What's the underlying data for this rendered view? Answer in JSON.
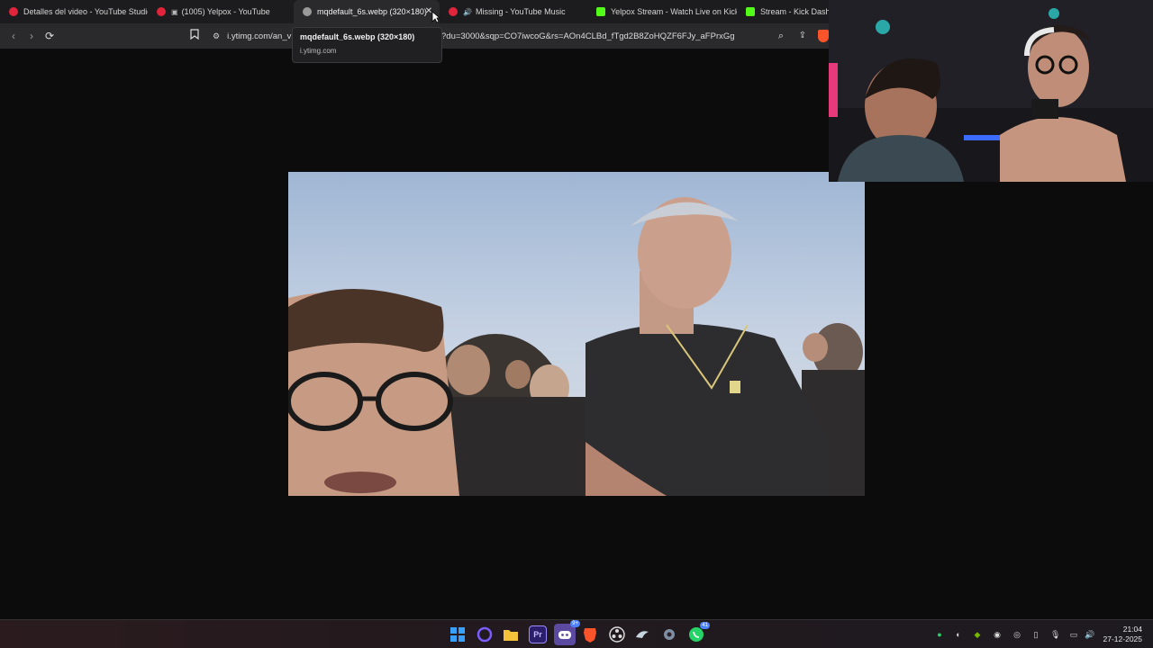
{
  "browser": {
    "tabs": [
      {
        "label": "Detalles del video - YouTube Studio",
        "icon": "youtube-studio-icon",
        "color": "#e0243b"
      },
      {
        "label": "(1005) Yelpox - YouTube",
        "icon": "youtube-icon",
        "color": "#e0243b"
      },
      {
        "label": "mqdefault_6s.webp (320×180)",
        "icon": "globe-icon",
        "color": "#b5b5b5"
      },
      {
        "label": "Missing - YouTube Music",
        "icon": "youtube-music-icon",
        "color": "#e0243b"
      },
      {
        "label": "Yelpox Stream - Watch Live on Kick",
        "icon": "kick-icon",
        "color": "#53fc18"
      },
      {
        "label": "Stream - Kick Dashb",
        "icon": "kick-icon",
        "color": "#53fc18"
      }
    ],
    "active_tab": 2,
    "address_bar": {
      "url_left": "i.ytimg.com/an_v",
      "url_right": "?du=3000&sqp=CO7iwcoG&rs=AOn4CLBd_fTgd2B8ZoHQZF6FJy_aFPrxGg"
    },
    "tooltip": {
      "title": "mqdefault_6s.webp (320×180)",
      "host": "i.ytimg.com"
    }
  },
  "image_viewer": {
    "description_icon": "photo-image"
  },
  "taskbar": {
    "pinned": [
      {
        "name": "windows-start-icon",
        "color": "#3aa0ff"
      },
      {
        "name": "cortana-icon",
        "color": "#7b5cff"
      },
      {
        "name": "file-explorer-icon",
        "color": "#f3c13a"
      },
      {
        "name": "premiere-icon",
        "color": "#2b1e6b"
      },
      {
        "name": "discord-icon",
        "color": "#5865f2"
      },
      {
        "name": "brave-icon",
        "color": "#fb542b"
      },
      {
        "name": "obs-icon",
        "color": "#555555"
      },
      {
        "name": "steam-icon",
        "color": "#1b2838"
      },
      {
        "name": "settings-icon",
        "color": "#7f8ea3"
      },
      {
        "name": "whatsapp-icon",
        "color": "#25d366"
      }
    ],
    "discord_badge": "9+",
    "whatsapp_badge": "41",
    "clock_time": "21:04",
    "clock_date": "27-12-2025"
  }
}
